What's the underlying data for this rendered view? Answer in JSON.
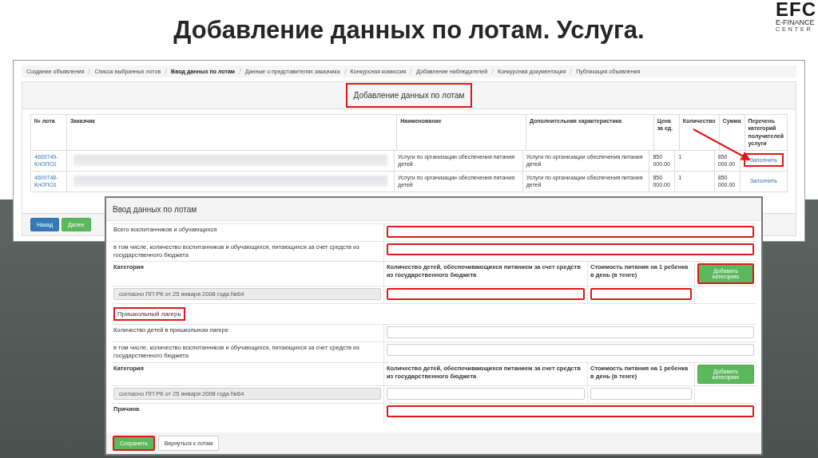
{
  "slide": {
    "title": "Добавление данных по лотам. Услуга.",
    "logo": {
      "mark": "EFC",
      "name": "E-FINANCE",
      "subname": "CENTER"
    }
  },
  "page": {
    "breadcrumbs": [
      {
        "label": "Создание объявления",
        "selected": false
      },
      {
        "label": "Список выбранных лотов",
        "selected": false
      },
      {
        "label": "Ввод данных по лотам",
        "selected": true
      },
      {
        "label": "Данные о представителях заказчика",
        "selected": false
      },
      {
        "label": "Конкурсная комиссия",
        "selected": false
      },
      {
        "label": "Добавление наблюдателей",
        "selected": false
      },
      {
        "label": "Конкурсная документация",
        "selected": false
      },
      {
        "label": "Публикация объявления",
        "selected": false
      }
    ],
    "panel_title": {
      "text": "Добавление данных по лотам",
      "highlighted": true
    },
    "table": {
      "columns": [
        "№ лота",
        "Заказчик",
        "Наименование",
        "Дополнительная характеристика",
        "Цена за ед.",
        "Количество",
        "Сумма",
        "Перечень категорий получателей услуги"
      ],
      "rows": [
        {
          "lot": "4600749-КлОПО1",
          "name": "Услуги по организации обеспечения питания детей",
          "extra": "Услуги по организации обеспечения питания детей",
          "price": "850 000.00",
          "quantity": "1",
          "sum": "850 000.00",
          "action": "Заполнить",
          "highlighted": true
        },
        {
          "lot": "4600748-КлОПО1",
          "name": "Услуги по организации обеспечения питания детей",
          "extra": "Услуги по организации обеспечения питания детей",
          "price": "850 000.00",
          "quantity": "1",
          "sum": "850 000.00",
          "action": "Заполнить",
          "highlighted": false
        }
      ]
    },
    "buttons": [
      {
        "label": "Назад",
        "kind": "primary"
      },
      {
        "label": "Далее",
        "kind": "success"
      }
    ]
  },
  "dialog": {
    "title": "Ввод данных по лотам",
    "rows": [
      {
        "kind": "input",
        "label": "Всего воспитанников и обучающихся",
        "bold": false,
        "highlighted": true
      },
      {
        "kind": "input",
        "label": "в том числе, количество воспитанников и обучающихся, питающихся за счет средств из государственного бюджета",
        "bold": false,
        "highlighted": true
      },
      {
        "kind": "category-header",
        "label": "Категория",
        "columns": [
          "Количество детей, обеспечивающихся питанием за счет средств из государственного бюджета",
          "Стоимость питания на 1 ребенка в день (в тенге)"
        ],
        "button": {
          "label": "Добавить категорию",
          "highlighted": true
        }
      },
      {
        "kind": "category-values",
        "value": "согласно ПП РК от 25 января 2008 года №64",
        "inputs": [
          {
            "highlighted": true
          },
          {
            "highlighted": true
          }
        ]
      },
      {
        "kind": "section",
        "label": "Пришкольный лагерь",
        "highlighted": true
      },
      {
        "kind": "input",
        "label": "Количество детей в пришкольном лагере",
        "bold": false,
        "highlighted": false
      },
      {
        "kind": "input",
        "label": "в том числе, количество воспитанников и обучающихся, питающихся за счет средств из государственного бюджета",
        "bold": false,
        "highlighted": false
      },
      {
        "kind": "category-header",
        "label": "Категория",
        "columns": [
          "Количество детей, обеспечивающихся питанием за счет средств из государственного бюджета",
          "Стоимость питания на 1 ребенка в день (в тенге)"
        ],
        "button": {
          "label": "Добавить категорию",
          "highlighted": false
        }
      },
      {
        "kind": "category-values",
        "value": "согласно ПП РК от 25 января 2008 года №64",
        "inputs": [
          {
            "highlighted": false
          },
          {
            "highlighted": false
          }
        ]
      },
      {
        "kind": "input",
        "label": "Причина",
        "bold": true,
        "highlighted": true
      }
    ],
    "buttons": [
      {
        "label": "Сохранить",
        "kind": "success",
        "highlighted": true
      },
      {
        "label": "Вернуться к лотам",
        "kind": "default",
        "highlighted": false
      }
    ]
  }
}
